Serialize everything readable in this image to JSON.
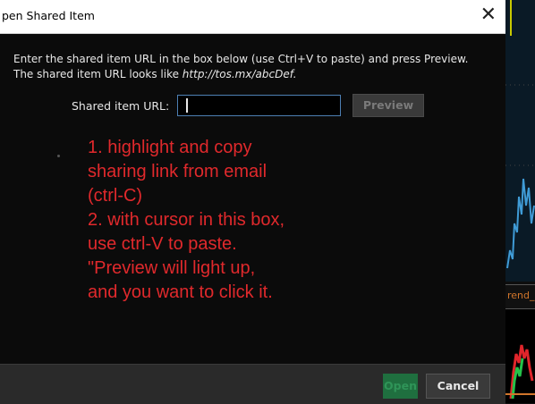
{
  "dialog": {
    "title": "pen Shared Item",
    "close_glyph": "✕",
    "instructions_line1": "Enter the shared item URL in the box below (use Ctrl+V to paste) and press Preview.",
    "instructions_line2_prefix": "The shared item URL looks like ",
    "instructions_example_url": "http://tos.mx/abcDef.",
    "url_label": "Shared item URL:",
    "url_value": "",
    "preview_label": "Preview",
    "open_label": "Open",
    "cancel_label": "Cancel"
  },
  "annotation": {
    "lines": [
      "1. highlight and copy",
      "sharing link from email",
      "(ctrl-C)",
      "2. with cursor in this box,",
      "use ctrl-V to paste.",
      "\"Preview will light up,",
      "and you want to click it."
    ],
    "color": "#e0292c"
  },
  "background_chart": {
    "study_label": "rend_",
    "colors": {
      "label": "#d1752b",
      "price": "#3f9bd6",
      "up": "#24c24a",
      "down": "#e0252b"
    }
  },
  "colors": {
    "dialog_bg": "#0b0b0b",
    "footer_bg": "#2a2a2a",
    "input_border": "#4d7fb3",
    "open_bg": "#1f6f3f"
  }
}
